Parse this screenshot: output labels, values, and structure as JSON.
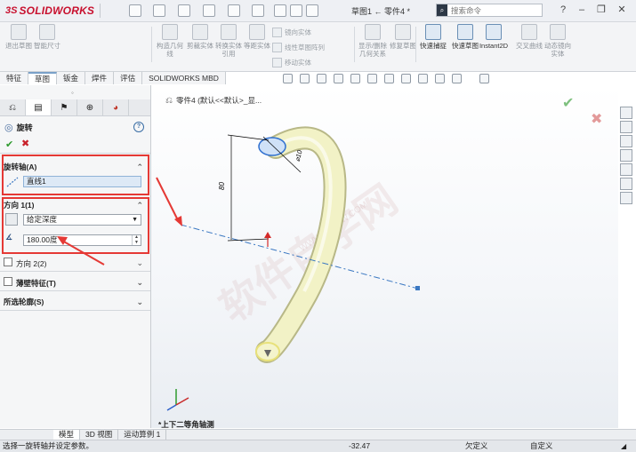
{
  "app": {
    "logo_ds": "3S",
    "logo_name": "SOLIDWORKS",
    "doc_title": "草图1 ← 零件4 *",
    "search_placeholder": "搜索命令"
  },
  "ribbon": {
    "buttons": [
      {
        "label": "退出草图",
        "icon": "exit-sketch-icon",
        "active": false
      },
      {
        "label": "智能尺寸",
        "icon": "smart-dimension-icon",
        "active": false
      },
      {
        "label": "构造几何线",
        "icon": "construction-geometry-icon",
        "active": false
      },
      {
        "label": "剪裁实体",
        "icon": "trim-entities-icon",
        "active": false
      },
      {
        "label": "转换实体引用",
        "icon": "convert-entities-icon",
        "active": false
      },
      {
        "label": "等距实体",
        "icon": "offset-entities-icon",
        "active": false
      },
      {
        "label": "显示/删除几何关系",
        "icon": "display-relations-icon",
        "active": false
      },
      {
        "label": "修复草图",
        "icon": "repair-sketch-icon",
        "active": false
      },
      {
        "label": "快速捕捉",
        "icon": "quick-snap-icon",
        "active": true
      },
      {
        "label": "快速草图",
        "icon": "rapid-sketch-icon",
        "active": true
      },
      {
        "label": "Instant2D",
        "icon": "instant2d-icon",
        "active": true
      },
      {
        "label": "交叉曲线",
        "icon": "intersection-curve-icon",
        "active": false
      },
      {
        "label": "动态镜向实体",
        "icon": "dynamic-mirror-icon",
        "active": false
      }
    ],
    "small": {
      "mirror": "镜向实体",
      "linear_pattern": "线性草图阵列",
      "move": "移动实体"
    }
  },
  "tabs": [
    "特征",
    "草图",
    "钣金",
    "焊件",
    "评估",
    "SOLIDWORKS MBD"
  ],
  "active_tab": "草图",
  "property_manager": {
    "title": "旋转",
    "group_axis": {
      "title": "旋转轴(A)",
      "value": "直线1"
    },
    "group_direction1": {
      "title": "方向 1(1)",
      "end_condition": "给定深度",
      "angle": "180.00度"
    },
    "direction2": "方向 2(2)",
    "thin_feature": "薄壁特征(T)",
    "selected_contours": "所选轮廓(S)"
  },
  "viewport": {
    "breadcrumb": "零件4 (默认<<默认>_显...",
    "view_label": "*上下二等角轴测",
    "dim_height": "80",
    "dim_diameter": "⌀10",
    "watermark": "软件自学网",
    "watermark_url": "WWW.RJZXW.COM"
  },
  "bottom_tabs": [
    "模型",
    "3D 视图",
    "运动算例 1"
  ],
  "active_bottom_tab": "模型",
  "status": {
    "message": "选择一旋转轴并设定参数。",
    "coord": "-32.47",
    "state1": "欠定义",
    "state2": "自定义"
  },
  "colors": {
    "accent_red": "#e53935",
    "part_yellow": "#f2f2c6",
    "axis_blue": "#3b78c2"
  }
}
